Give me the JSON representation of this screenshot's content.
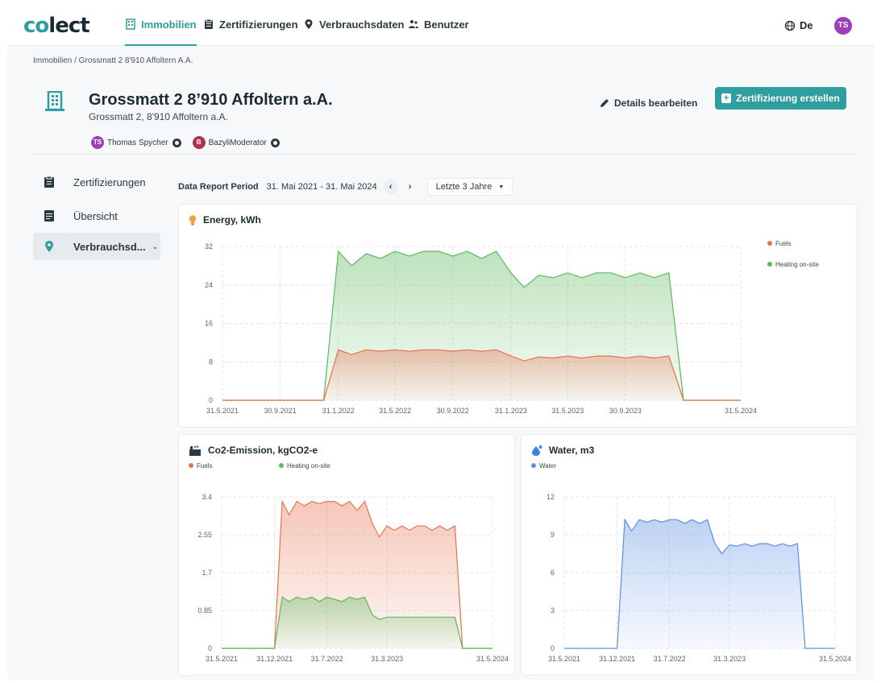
{
  "nav": {
    "logo": "colect",
    "items": [
      {
        "label": "Immobilien",
        "icon": "building-icon",
        "active": true
      },
      {
        "label": "Zertifizierungen",
        "icon": "clipboard-icon",
        "active": false
      },
      {
        "label": "Verbrauchsdaten",
        "icon": "pin-icon",
        "active": false
      },
      {
        "label": "Benutzer",
        "icon": "users-icon",
        "active": false
      }
    ],
    "language": "De",
    "user_initials": "TS"
  },
  "breadcrumb": "Immobilien / Grossmatt 2 8'910 Affoltern A.A.",
  "property": {
    "title": "Grossmatt 2 8’910 Affoltern a.A.",
    "address": "Grossmatt 2, 8'910 Affoltern a.A.",
    "users": [
      {
        "initials": "TS",
        "name": "Thomas Spycher",
        "color": "#9c3fb8"
      },
      {
        "initials": "B",
        "name": "BazyliModerator",
        "color": "#b0304e"
      }
    ]
  },
  "actions": {
    "edit_label": "Details bearbeiten",
    "create_label": "Zertifizierung erstellen"
  },
  "sidebar": {
    "items": [
      {
        "label": "Zertifizierungen",
        "active": false
      },
      {
        "label": "Übersicht",
        "active": false
      },
      {
        "label": "Verbrauchsd...",
        "active": true
      }
    ]
  },
  "period": {
    "label": "Data Report Period",
    "range": "31. Mai 2021 - 31. Mai 2024",
    "prev": "‹",
    "next": "›",
    "selected": "Letzte 3 Jahre"
  },
  "colors": {
    "accent": "#2f9ea0",
    "fuels": "#e5734f",
    "heating": "#5cb85c",
    "water": "#5b8fe0"
  },
  "chart_data": [
    {
      "type": "area",
      "title": "Energy, kWh",
      "x_ticks": [
        "31.5.2021",
        "30.9.2021",
        "31.1.2022",
        "31.5.2022",
        "30.9.2022",
        "31.1.2023",
        "31.5.2023",
        "30.9.2023",
        "31.5.2024"
      ],
      "x_start": "2021-05-31",
      "x_end": "2024-05-31",
      "ylim": [
        0,
        32
      ],
      "y_ticks": [
        "0",
        "8",
        "16",
        "24",
        "32"
      ],
      "legend": "right",
      "series": [
        {
          "name": "Heating on-site",
          "color": "#5cb85c",
          "points": [
            [
              "2021-05-31",
              0
            ],
            [
              "2021-12-31",
              0
            ],
            [
              "2022-01-31",
              31
            ],
            [
              "2022-02-28",
              28
            ],
            [
              "2022-03-31",
              30.5
            ],
            [
              "2022-04-30",
              29.5
            ],
            [
              "2022-05-31",
              31
            ],
            [
              "2022-06-30",
              30
            ],
            [
              "2022-07-31",
              31
            ],
            [
              "2022-08-31",
              31
            ],
            [
              "2022-09-30",
              30
            ],
            [
              "2022-10-31",
              31
            ],
            [
              "2022-11-30",
              29.5
            ],
            [
              "2022-12-31",
              31
            ],
            [
              "2023-01-31",
              26.5
            ],
            [
              "2023-02-28",
              23.5
            ],
            [
              "2023-03-31",
              26
            ],
            [
              "2023-04-30",
              25.5
            ],
            [
              "2023-05-31",
              26.5
            ],
            [
              "2023-06-30",
              25.5
            ],
            [
              "2023-07-31",
              26.5
            ],
            [
              "2023-08-31",
              26.5
            ],
            [
              "2023-09-30",
              25.5
            ],
            [
              "2023-10-31",
              26.5
            ],
            [
              "2023-11-30",
              25.5
            ],
            [
              "2023-12-31",
              26.5
            ],
            [
              "2024-01-31",
              0
            ],
            [
              "2024-05-31",
              0
            ]
          ]
        },
        {
          "name": "Fuels",
          "color": "#e5734f",
          "points": [
            [
              "2021-05-31",
              0
            ],
            [
              "2021-12-31",
              0
            ],
            [
              "2022-01-31",
              10.5
            ],
            [
              "2022-02-28",
              9.5
            ],
            [
              "2022-03-31",
              10.5
            ],
            [
              "2022-04-30",
              10.2
            ],
            [
              "2022-05-31",
              10.5
            ],
            [
              "2022-06-30",
              10.2
            ],
            [
              "2022-07-31",
              10.5
            ],
            [
              "2022-08-31",
              10.5
            ],
            [
              "2022-09-30",
              10.2
            ],
            [
              "2022-10-31",
              10.5
            ],
            [
              "2022-11-30",
              10.2
            ],
            [
              "2022-12-31",
              10.5
            ],
            [
              "2023-01-31",
              9.2
            ],
            [
              "2023-02-28",
              8.2
            ],
            [
              "2023-03-31",
              9
            ],
            [
              "2023-04-30",
              8.8
            ],
            [
              "2023-05-31",
              9.2
            ],
            [
              "2023-06-30",
              8.8
            ],
            [
              "2023-07-31",
              9.2
            ],
            [
              "2023-08-31",
              9.2
            ],
            [
              "2023-09-30",
              8.8
            ],
            [
              "2023-10-31",
              9.2
            ],
            [
              "2023-11-30",
              8.8
            ],
            [
              "2023-12-31",
              9.2
            ],
            [
              "2024-01-31",
              0
            ],
            [
              "2024-05-31",
              0
            ]
          ]
        }
      ]
    },
    {
      "type": "area",
      "title": "Co2-Emission, kgCO2-e",
      "x_ticks": [
        "31.5.2021",
        "31.12.2021",
        "31.7.2022",
        "31.3.2023",
        "31.5.2024"
      ],
      "x_start": "2021-05-31",
      "x_end": "2024-05-31",
      "ylim": [
        0,
        3.4
      ],
      "y_ticks": [
        "0",
        "0.85",
        "1.7",
        "2.55",
        "3.4"
      ],
      "legend": "top-left",
      "series": [
        {
          "name": "Fuels",
          "color": "#e5734f",
          "points": [
            [
              "2021-05-31",
              0
            ],
            [
              "2021-12-31",
              0
            ],
            [
              "2022-01-31",
              3.3
            ],
            [
              "2022-02-28",
              3.0
            ],
            [
              "2022-03-31",
              3.3
            ],
            [
              "2022-04-30",
              3.2
            ],
            [
              "2022-05-31",
              3.3
            ],
            [
              "2022-06-30",
              3.25
            ],
            [
              "2022-07-31",
              3.3
            ],
            [
              "2022-08-31",
              3.3
            ],
            [
              "2022-09-30",
              3.2
            ],
            [
              "2022-10-31",
              3.3
            ],
            [
              "2022-11-30",
              3.1
            ],
            [
              "2022-12-31",
              3.3
            ],
            [
              "2023-01-31",
              2.8
            ],
            [
              "2023-02-28",
              2.5
            ],
            [
              "2023-03-31",
              2.75
            ],
            [
              "2023-04-30",
              2.65
            ],
            [
              "2023-05-31",
              2.75
            ],
            [
              "2023-06-30",
              2.65
            ],
            [
              "2023-07-31",
              2.75
            ],
            [
              "2023-08-31",
              2.75
            ],
            [
              "2023-09-30",
              2.65
            ],
            [
              "2023-10-31",
              2.75
            ],
            [
              "2023-11-30",
              2.65
            ],
            [
              "2023-12-31",
              2.75
            ],
            [
              "2024-01-31",
              0
            ],
            [
              "2024-05-31",
              0
            ]
          ]
        },
        {
          "name": "Heating on-site",
          "color": "#5cb85c",
          "points": [
            [
              "2021-05-31",
              0
            ],
            [
              "2021-12-31",
              0
            ],
            [
              "2022-01-31",
              1.15
            ],
            [
              "2022-02-28",
              1.05
            ],
            [
              "2022-03-31",
              1.15
            ],
            [
              "2022-04-30",
              1.1
            ],
            [
              "2022-05-31",
              1.15
            ],
            [
              "2022-06-30",
              1.05
            ],
            [
              "2022-07-31",
              1.15
            ],
            [
              "2022-08-31",
              1.1
            ],
            [
              "2022-09-30",
              1.05
            ],
            [
              "2022-10-31",
              1.15
            ],
            [
              "2022-11-30",
              1.1
            ],
            [
              "2022-12-31",
              1.15
            ],
            [
              "2023-01-31",
              0.75
            ],
            [
              "2023-02-28",
              0.65
            ],
            [
              "2023-03-31",
              0.7
            ],
            [
              "2023-04-30",
              0.7
            ],
            [
              "2023-05-31",
              0.7
            ],
            [
              "2023-06-30",
              0.7
            ],
            [
              "2023-07-31",
              0.7
            ],
            [
              "2023-08-31",
              0.7
            ],
            [
              "2023-09-30",
              0.7
            ],
            [
              "2023-10-31",
              0.7
            ],
            [
              "2023-11-30",
              0.7
            ],
            [
              "2023-12-31",
              0.7
            ],
            [
              "2024-01-31",
              0
            ],
            [
              "2024-05-31",
              0
            ]
          ]
        }
      ]
    },
    {
      "type": "area",
      "title": "Water, m3",
      "x_ticks": [
        "31.5.2021",
        "31.12.2021",
        "31.7.2022",
        "31.3.2023",
        "31.5.2024"
      ],
      "x_start": "2021-05-31",
      "x_end": "2024-05-31",
      "ylim": [
        0,
        12
      ],
      "y_ticks": [
        "0",
        "3",
        "6",
        "9",
        "12"
      ],
      "legend": "top-left",
      "series": [
        {
          "name": "Water",
          "color": "#5b8fe0",
          "points": [
            [
              "2021-05-31",
              0
            ],
            [
              "2021-12-31",
              0
            ],
            [
              "2022-01-31",
              10.2
            ],
            [
              "2022-02-28",
              9.3
            ],
            [
              "2022-03-31",
              10.2
            ],
            [
              "2022-04-30",
              10
            ],
            [
              "2022-05-31",
              10.2
            ],
            [
              "2022-06-30",
              10
            ],
            [
              "2022-07-31",
              10.2
            ],
            [
              "2022-08-31",
              10.2
            ],
            [
              "2022-09-30",
              9.9
            ],
            [
              "2022-10-31",
              10.2
            ],
            [
              "2022-11-30",
              9.9
            ],
            [
              "2022-12-31",
              10.2
            ],
            [
              "2023-01-31",
              8.3
            ],
            [
              "2023-02-28",
              7.5
            ],
            [
              "2023-03-31",
              8.2
            ],
            [
              "2023-04-30",
              8.1
            ],
            [
              "2023-05-31",
              8.3
            ],
            [
              "2023-06-30",
              8.1
            ],
            [
              "2023-07-31",
              8.3
            ],
            [
              "2023-08-31",
              8.3
            ],
            [
              "2023-09-30",
              8.1
            ],
            [
              "2023-10-31",
              8.3
            ],
            [
              "2023-11-30",
              8.1
            ],
            [
              "2023-12-31",
              8.3
            ],
            [
              "2024-01-31",
              0
            ],
            [
              "2024-05-31",
              0
            ]
          ]
        }
      ]
    }
  ]
}
